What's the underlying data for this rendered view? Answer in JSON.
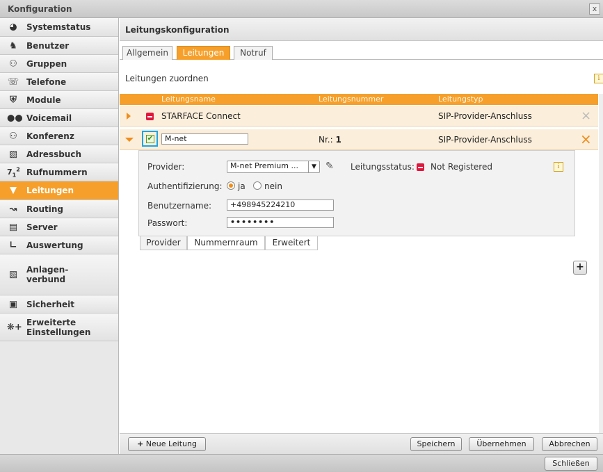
{
  "window": {
    "title": "Konfiguration",
    "close": "x"
  },
  "sidebar": {
    "items": [
      {
        "label": "Systemstatus",
        "icon": "gauge-icon"
      },
      {
        "label": "Benutzer",
        "icon": "user-icon"
      },
      {
        "label": "Gruppen",
        "icon": "group-icon"
      },
      {
        "label": "Telefone",
        "icon": "phone-icon"
      },
      {
        "label": "Module",
        "icon": "module-icon"
      },
      {
        "label": "Voicemail",
        "icon": "voicemail-icon"
      },
      {
        "label": "Konferenz",
        "icon": "conference-icon"
      },
      {
        "label": "Adressbuch",
        "icon": "addressbook-icon"
      },
      {
        "label": "Rufnummern",
        "icon": "numbers-icon"
      },
      {
        "label": "Leitungen",
        "icon": "plug-icon"
      },
      {
        "label": "Routing",
        "icon": "routing-icon"
      },
      {
        "label": "Server",
        "icon": "server-icon"
      },
      {
        "label": "Auswertung",
        "icon": "chart-icon"
      },
      {
        "label": "Anlagen-verbund",
        "icon": "network-icon"
      },
      {
        "label": "Sicherheit",
        "icon": "lock-icon"
      },
      {
        "label": "Erweiterte Einstellungen",
        "icon": "advanced-settings-icon"
      }
    ],
    "active": "Leitungen"
  },
  "main": {
    "title": "Leitungskonfiguration",
    "tabs": [
      {
        "label": "Allgemein"
      },
      {
        "label": "Leitungen"
      },
      {
        "label": "Notruf"
      }
    ],
    "active_tab": "Leitungen",
    "section_title": "Leitungen zuordnen",
    "table": {
      "columns": [
        "Leitungsname",
        "Leitungsnummer",
        "Leitungstyp"
      ],
      "rows": [
        {
          "name": "STARFACE Connect",
          "type": "SIP-Provider-Anschluss",
          "expanded": false
        },
        {
          "name": "M-net",
          "number_label": "Nr.:",
          "number": "1",
          "type": "SIP-Provider-Anschluss",
          "expanded": true,
          "enabled": true
        }
      ]
    },
    "detail": {
      "provider_label": "Provider:",
      "provider_value": "M-net Premium ...",
      "status_label": "Leitungsstatus:",
      "status_value": "Not Registered",
      "auth_label": "Authentifizierung:",
      "auth_yes": "ja",
      "auth_no": "nein",
      "auth_selected": "ja",
      "username_label": "Benutzername:",
      "username_value": "+498945224210",
      "password_label": "Passwort:",
      "password_value": "••••••••",
      "tabs": [
        "Provider",
        "Nummernraum",
        "Erweitert"
      ]
    },
    "buttons": {
      "new_line": "Neue Leitung",
      "save": "Speichern",
      "apply": "Übernehmen",
      "cancel": "Abbrechen"
    }
  },
  "footer": {
    "close": "Schließen"
  },
  "colors": {
    "accent": "#f6a02b",
    "error": "#e1163c",
    "highlight": "#1aa6e6"
  }
}
